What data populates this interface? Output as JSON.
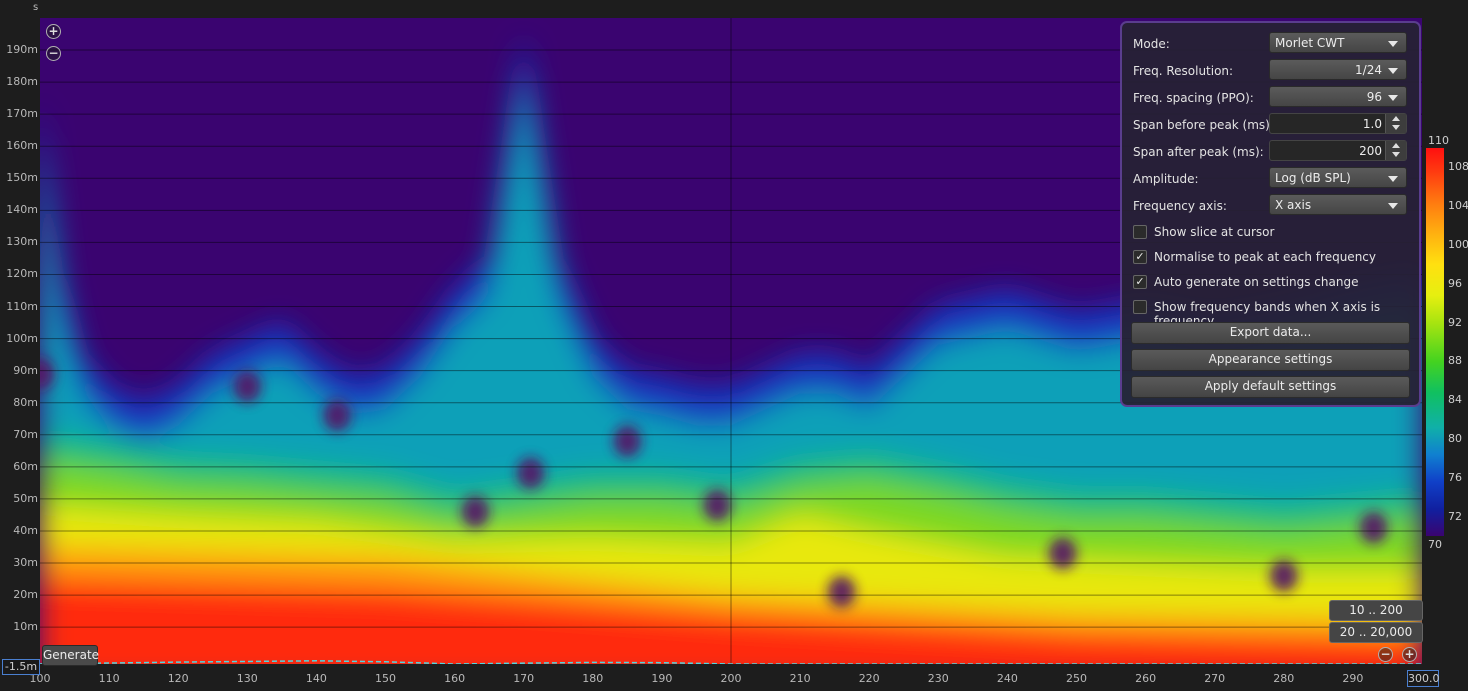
{
  "axis_corner_unit": "s",
  "chart_data": {
    "type": "heatmap",
    "title": "",
    "xlabel": "",
    "ylabel": "",
    "x_axis_ticks": [
      "100",
      "110",
      "120",
      "130",
      "140",
      "150",
      "160",
      "170",
      "180",
      "190",
      "200",
      "210",
      "220",
      "230",
      "240",
      "250",
      "260",
      "270",
      "280",
      "290"
    ],
    "x_range_end_label": "300.0",
    "y_axis_ticks": [
      "190m",
      "180m",
      "170m",
      "160m",
      "150m",
      "140m",
      "130m",
      "120m",
      "110m",
      "100m",
      "90m",
      "80m",
      "70m",
      "60m",
      "50m",
      "40m",
      "30m",
      "20m",
      "10m"
    ],
    "y_range_start_label": "-1.5m",
    "colorbar_ticks": [
      "110",
      "108",
      "104",
      "100",
      "96",
      "92",
      "88",
      "84",
      "80",
      "76",
      "72",
      "70"
    ],
    "colorbar_range": [
      70,
      110
    ],
    "decay_contour_ms": [
      {
        "freq": 100,
        "ms": 175
      },
      {
        "freq": 103,
        "ms": 120
      },
      {
        "freq": 106,
        "ms": 95
      },
      {
        "freq": 110,
        "ms": 85
      },
      {
        "freq": 115,
        "ms": 80
      },
      {
        "freq": 120,
        "ms": 85
      },
      {
        "freq": 125,
        "ms": 95
      },
      {
        "freq": 130,
        "ms": 100
      },
      {
        "freq": 135,
        "ms": 105
      },
      {
        "freq": 140,
        "ms": 95
      },
      {
        "freq": 145,
        "ms": 88
      },
      {
        "freq": 150,
        "ms": 90
      },
      {
        "freq": 155,
        "ms": 100
      },
      {
        "freq": 160,
        "ms": 115
      },
      {
        "freq": 165,
        "ms": 125
      },
      {
        "freq": 170,
        "ms": 195
      },
      {
        "freq": 175,
        "ms": 125
      },
      {
        "freq": 180,
        "ms": 100
      },
      {
        "freq": 185,
        "ms": 90
      },
      {
        "freq": 190,
        "ms": 88
      },
      {
        "freq": 195,
        "ms": 85
      },
      {
        "freq": 200,
        "ms": 85
      },
      {
        "freq": 205,
        "ms": 90
      },
      {
        "freq": 210,
        "ms": 95
      },
      {
        "freq": 215,
        "ms": 95
      },
      {
        "freq": 220,
        "ms": 90
      },
      {
        "freq": 225,
        "ms": 100
      },
      {
        "freq": 230,
        "ms": 110
      },
      {
        "freq": 240,
        "ms": 115
      },
      {
        "freq": 250,
        "ms": 108
      },
      {
        "freq": 260,
        "ms": 112
      },
      {
        "freq": 270,
        "ms": 108
      },
      {
        "freq": 280,
        "ms": 112
      },
      {
        "freq": 290,
        "ms": 118
      },
      {
        "freq": 300,
        "ms": 122
      }
    ],
    "decay_84db_ms": [
      {
        "freq": 100,
        "ms": 70
      },
      {
        "freq": 110,
        "ms": 67
      },
      {
        "freq": 120,
        "ms": 63
      },
      {
        "freq": 130,
        "ms": 62
      },
      {
        "freq": 140,
        "ms": 60
      },
      {
        "freq": 150,
        "ms": 58
      },
      {
        "freq": 160,
        "ms": 52
      },
      {
        "freq": 170,
        "ms": 55
      },
      {
        "freq": 180,
        "ms": 58
      },
      {
        "freq": 190,
        "ms": 58
      },
      {
        "freq": 200,
        "ms": 55
      },
      {
        "freq": 210,
        "ms": 62
      },
      {
        "freq": 220,
        "ms": 64
      },
      {
        "freq": 230,
        "ms": 60
      },
      {
        "freq": 240,
        "ms": 55
      },
      {
        "freq": 250,
        "ms": 52
      },
      {
        "freq": 260,
        "ms": 52
      },
      {
        "freq": 270,
        "ms": 50
      },
      {
        "freq": 280,
        "ms": 48
      },
      {
        "freq": 290,
        "ms": 50
      },
      {
        "freq": 300,
        "ms": 52
      }
    ],
    "decay_96db_ms": [
      {
        "freq": 100,
        "ms": 48
      },
      {
        "freq": 120,
        "ms": 45
      },
      {
        "freq": 140,
        "ms": 43
      },
      {
        "freq": 160,
        "ms": 37
      },
      {
        "freq": 180,
        "ms": 38
      },
      {
        "freq": 200,
        "ms": 36
      },
      {
        "freq": 210,
        "ms": 45
      },
      {
        "freq": 220,
        "ms": 40
      },
      {
        "freq": 240,
        "ms": 32
      },
      {
        "freq": 260,
        "ms": 30
      },
      {
        "freq": 280,
        "ms": 28
      },
      {
        "freq": 300,
        "ms": 28
      }
    ],
    "decay_104db_ms": [
      {
        "freq": 100,
        "ms": 35
      },
      {
        "freq": 150,
        "ms": 32
      },
      {
        "freq": 200,
        "ms": 20
      },
      {
        "freq": 250,
        "ms": 14
      },
      {
        "freq": 300,
        "ms": 12
      }
    ],
    "decay_108db_ms": [
      {
        "freq": 100,
        "ms": 25
      },
      {
        "freq": 150,
        "ms": 22
      },
      {
        "freq": 200,
        "ms": 14
      },
      {
        "freq": 250,
        "ms": 8
      },
      {
        "freq": 300,
        "ms": 6
      }
    ],
    "hot_spots": [
      {
        "freq": 100,
        "ms": 89
      },
      {
        "freq": 130,
        "ms": 85
      },
      {
        "freq": 143,
        "ms": 76
      },
      {
        "freq": 163,
        "ms": 46
      },
      {
        "freq": 171,
        "ms": 58
      },
      {
        "freq": 185,
        "ms": 68
      },
      {
        "freq": 198,
        "ms": 48
      },
      {
        "freq": 216,
        "ms": 21
      },
      {
        "freq": 248,
        "ms": 33
      },
      {
        "freq": 280,
        "ms": 26
      },
      {
        "freq": 293,
        "ms": 41
      }
    ],
    "dashed_overlay_ms": [
      {
        "freq": 100,
        "ms": -1.5
      },
      {
        "freq": 120,
        "ms": -0.9
      },
      {
        "freq": 140,
        "ms": -0.5
      },
      {
        "freq": 150,
        "ms": -0.8
      },
      {
        "freq": 160,
        "ms": -1.5
      },
      {
        "freq": 180,
        "ms": -1.0
      },
      {
        "freq": 190,
        "ms": -1.1
      },
      {
        "freq": 200,
        "ms": -1.5
      },
      {
        "freq": 300,
        "ms": -1.5
      }
    ]
  },
  "panel": {
    "mode_label": "Mode:",
    "mode_value": "Morlet CWT",
    "freq_res_label": "Freq. Resolution:",
    "freq_res_value": "1/24",
    "freq_spacing_label": "Freq. spacing (PPO):",
    "freq_spacing_value": "96",
    "span_before_label": "Span before peak (ms):",
    "span_before_value": "1.0",
    "span_after_label": "Span after peak (ms):",
    "span_after_value": "200",
    "amplitude_label": "Amplitude:",
    "amplitude_value": "Log (dB SPL)",
    "freq_axis_label": "Frequency axis:",
    "freq_axis_value": "X axis",
    "show_slice_label": "Show slice at cursor",
    "show_slice_checked": "",
    "normalise_label": "Normalise to peak at each frequency",
    "normalise_checked": "✓",
    "auto_generate_label": "Auto generate on settings change",
    "auto_generate_checked": "✓",
    "show_bands_label": "Show frequency bands when X axis is frequency",
    "show_bands_checked": "",
    "export_label": "Export data...",
    "appearance_label": "Appearance settings",
    "defaults_label": "Apply default settings"
  },
  "range_buttons": {
    "time_range": "10 .. 200",
    "freq_range": "20 .. 20,000"
  },
  "generate_label": "Generate",
  "zoom": {
    "in": "+",
    "out": "−"
  }
}
